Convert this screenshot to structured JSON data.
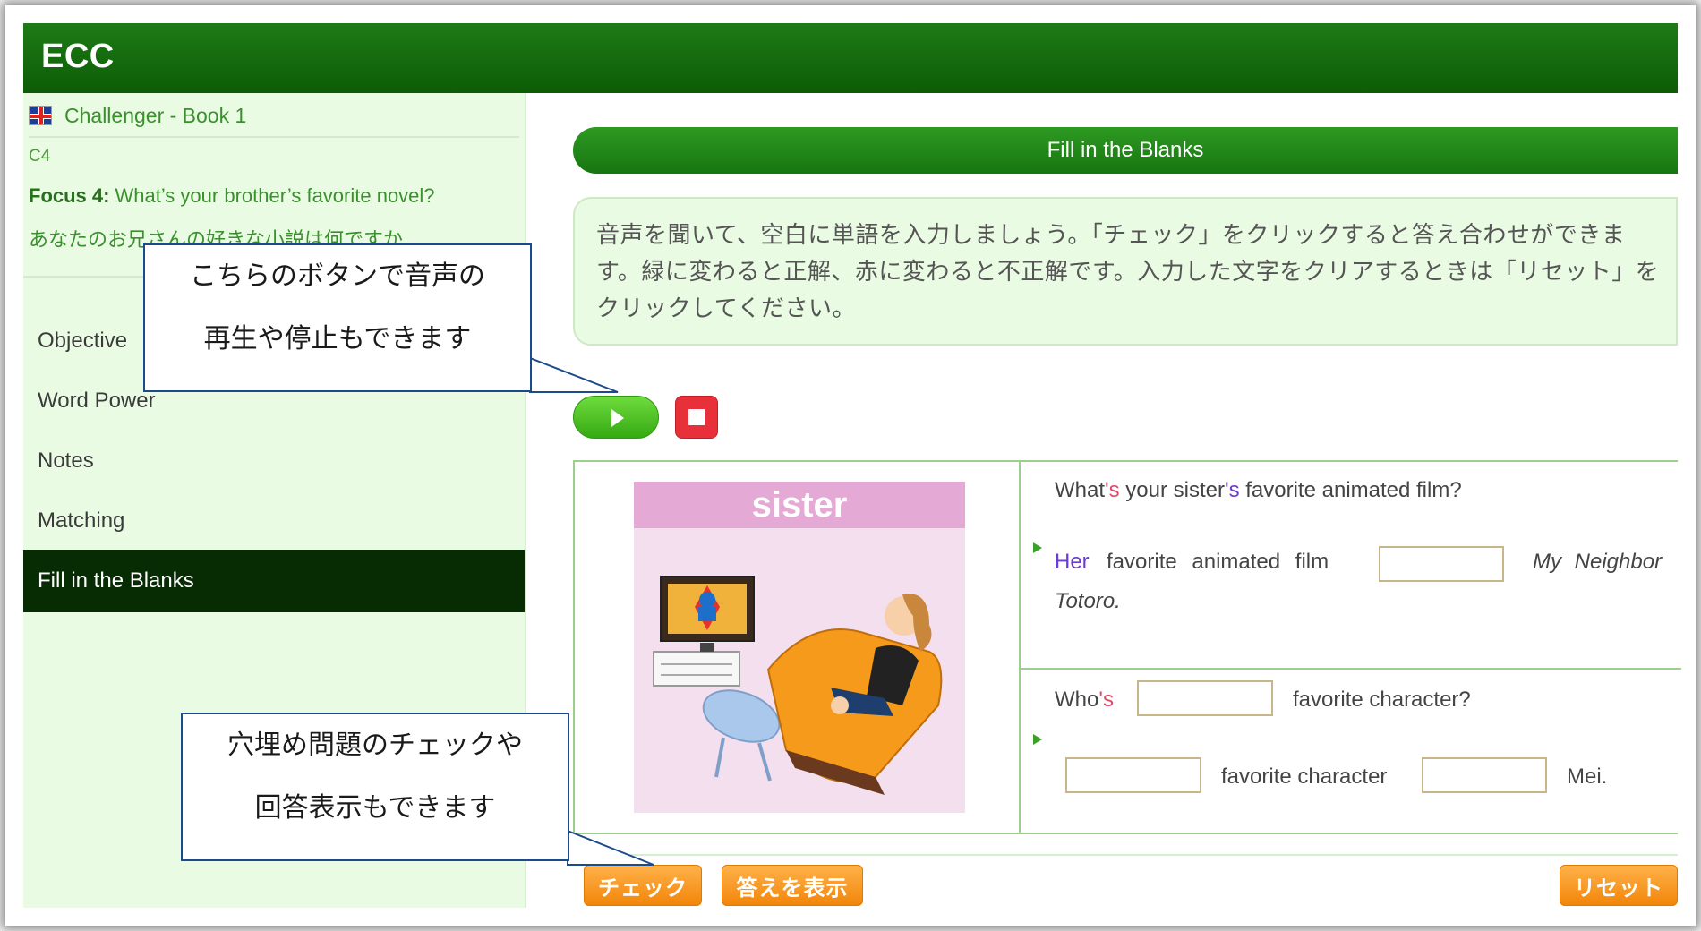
{
  "app": {
    "logo": "ECC"
  },
  "sidebar": {
    "book_title": "Challenger - Book 1",
    "unit_code": "C4",
    "focus_label": "Focus 4:",
    "focus_text": "What’s your brother’s favorite novel?",
    "focus_jp": "あなたのお兄さんの好きな小説は何ですか",
    "items": [
      {
        "label": "Objective",
        "active": false
      },
      {
        "label": "Word Power",
        "active": false
      },
      {
        "label": "Notes",
        "active": false
      },
      {
        "label": "Matching",
        "active": false
      },
      {
        "label": "Fill in the Blanks",
        "active": true
      }
    ]
  },
  "main": {
    "section_title": "Fill in the Blanks",
    "instructions": "音声を聞いて、空白に単語を入力しましょう。「チェック」をクリックすると答え合わせができます。緑に変わると正解、赤に変わると不正解です。入力した文字をクリアするときは「リセット」をクリックしてください。",
    "illustration_label": "sister",
    "q1": {
      "prompt_a": "What",
      "prompt_b": "'s",
      "prompt_c": " your sister",
      "prompt_d": "'s",
      "prompt_e": " favorite animated film?",
      "ans_her": "Her",
      "ans_middle": "favorite animated film",
      "ans_title_1": "My Neighbor",
      "ans_title_2": "Totoro."
    },
    "q2": {
      "prompt_a": "Who",
      "prompt_b": "'s",
      "prompt_end": "favorite character?",
      "ans_middle": "favorite character",
      "ans_end": "Mei."
    },
    "buttons": {
      "check": "チェック",
      "show_answer": "答えを表示",
      "reset": "リセット"
    }
  },
  "callouts": {
    "top_line1": "こちらのボタンで音声の",
    "top_line2": "再生や停止もできます",
    "bottom_line1": "穴埋め問題のチェックや",
    "bottom_line2": "回答表示もできます"
  },
  "colors": {
    "header_green": "#0c5c06",
    "accent_orange": "#f2860a",
    "sidebar_bg": "#eafbe3"
  }
}
